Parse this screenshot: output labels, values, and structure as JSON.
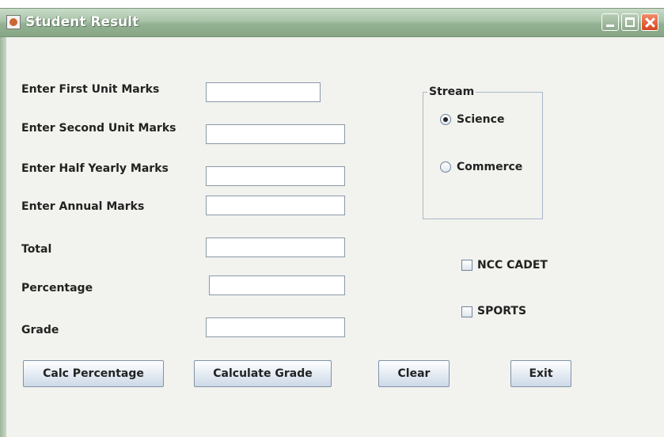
{
  "window": {
    "title": "Student Result"
  },
  "icons": {
    "app": "java-app-icon",
    "minimize": "minimize-icon",
    "maximize": "maximize-icon",
    "close": "close-icon"
  },
  "form": {
    "first_unit_label": "Enter First Unit Marks",
    "second_unit_label": "Enter Second Unit Marks",
    "half_yearly_label": "Enter Half Yearly Marks",
    "annual_label": "Enter Annual Marks",
    "total_label": "Total",
    "percentage_label": "Percentage",
    "grade_label": "Grade",
    "first_unit_value": "",
    "second_unit_value": "",
    "half_yearly_value": "",
    "annual_value": "",
    "total_value": "",
    "percentage_value": "",
    "grade_value": ""
  },
  "stream": {
    "title": "Stream",
    "options": [
      {
        "label": "Science",
        "selected": true
      },
      {
        "label": "Commerce",
        "selected": false
      }
    ]
  },
  "extras": {
    "ncc_label": "NCC CADET",
    "ncc_checked": false,
    "sports_label": "SPORTS",
    "sports_checked": false
  },
  "buttons": {
    "calc_percentage": "Calc Percentage",
    "calculate_grade": "Calculate Grade",
    "clear": "Clear",
    "exit": "Exit"
  },
  "colors": {
    "titlebar": "#94b293",
    "content_bg": "#f2f2ee",
    "close_button": "#d6451e"
  }
}
